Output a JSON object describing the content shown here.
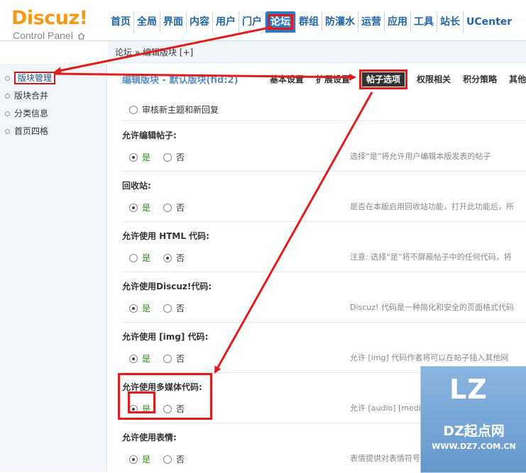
{
  "header": {
    "logo_title": "Discuz!",
    "logo_subtitle": "Control Panel",
    "nav": [
      "首页",
      "全局",
      "界面",
      "内容",
      "用户",
      "门户",
      "论坛",
      "群组",
      "防灌水",
      "运营",
      "应用",
      "工具",
      "站长",
      "UCenter"
    ],
    "active_nav": "论坛"
  },
  "breadcrumb": "论坛 » 编辑版块 [+]",
  "sidebar": {
    "items": [
      {
        "label": "版块管理",
        "active": true
      },
      {
        "label": "版块合并",
        "active": false
      },
      {
        "label": "分类信息",
        "active": false
      },
      {
        "label": "首页四格",
        "active": false
      }
    ]
  },
  "main": {
    "section_title": "编辑版块 - 默认版块(fid:2)",
    "tabs": [
      "基本设置",
      "扩展设置",
      "帖子选项",
      "权限相关",
      "积分策略",
      "其他"
    ],
    "active_tab": "帖子选项",
    "top_option": "审核新主题和新回复",
    "yes": "是",
    "no": "否",
    "settings": [
      {
        "label": "允许编辑帖子:",
        "value": "yes",
        "hint": "选择“是”将允许用户编辑本版发表的帖子"
      },
      {
        "label": "回收站:",
        "value": "yes",
        "hint": "是否在本版启用回收站功能，打开此功能后，所"
      },
      {
        "label": "允许使用 HTML 代码:",
        "value": "no",
        "hint": "注意: 选择“是”将不屏蔽帖子中的任何代码，将"
      },
      {
        "label": "允许使用Discuz!代码:",
        "value": "yes",
        "hint": "Discuz! 代码是一种简化和安全的页面格式代码"
      },
      {
        "label": "允许使用 [img] 代码:",
        "value": "yes",
        "hint": "允许 [img] 代码作者将可以在帖子插入其他网"
      },
      {
        "label": "允许使用多媒体代码:",
        "value": "yes",
        "hint": "允许 [audio] [media] [flash] 等多媒体代码后"
      },
      {
        "label": "允许使用表情:",
        "value": "yes",
        "hint": "表情提供对表情符号，如“:)”的解析，使之作为"
      }
    ]
  },
  "watermark": {
    "logo": "LZ",
    "title": "DZ起点网",
    "url": "WWW.DZ7.COM.CN"
  },
  "colors": {
    "accent": "#2f7bc0",
    "highlight": "#e21b1b",
    "logo": "#f29b1b",
    "yes": "#2c8d1a"
  }
}
